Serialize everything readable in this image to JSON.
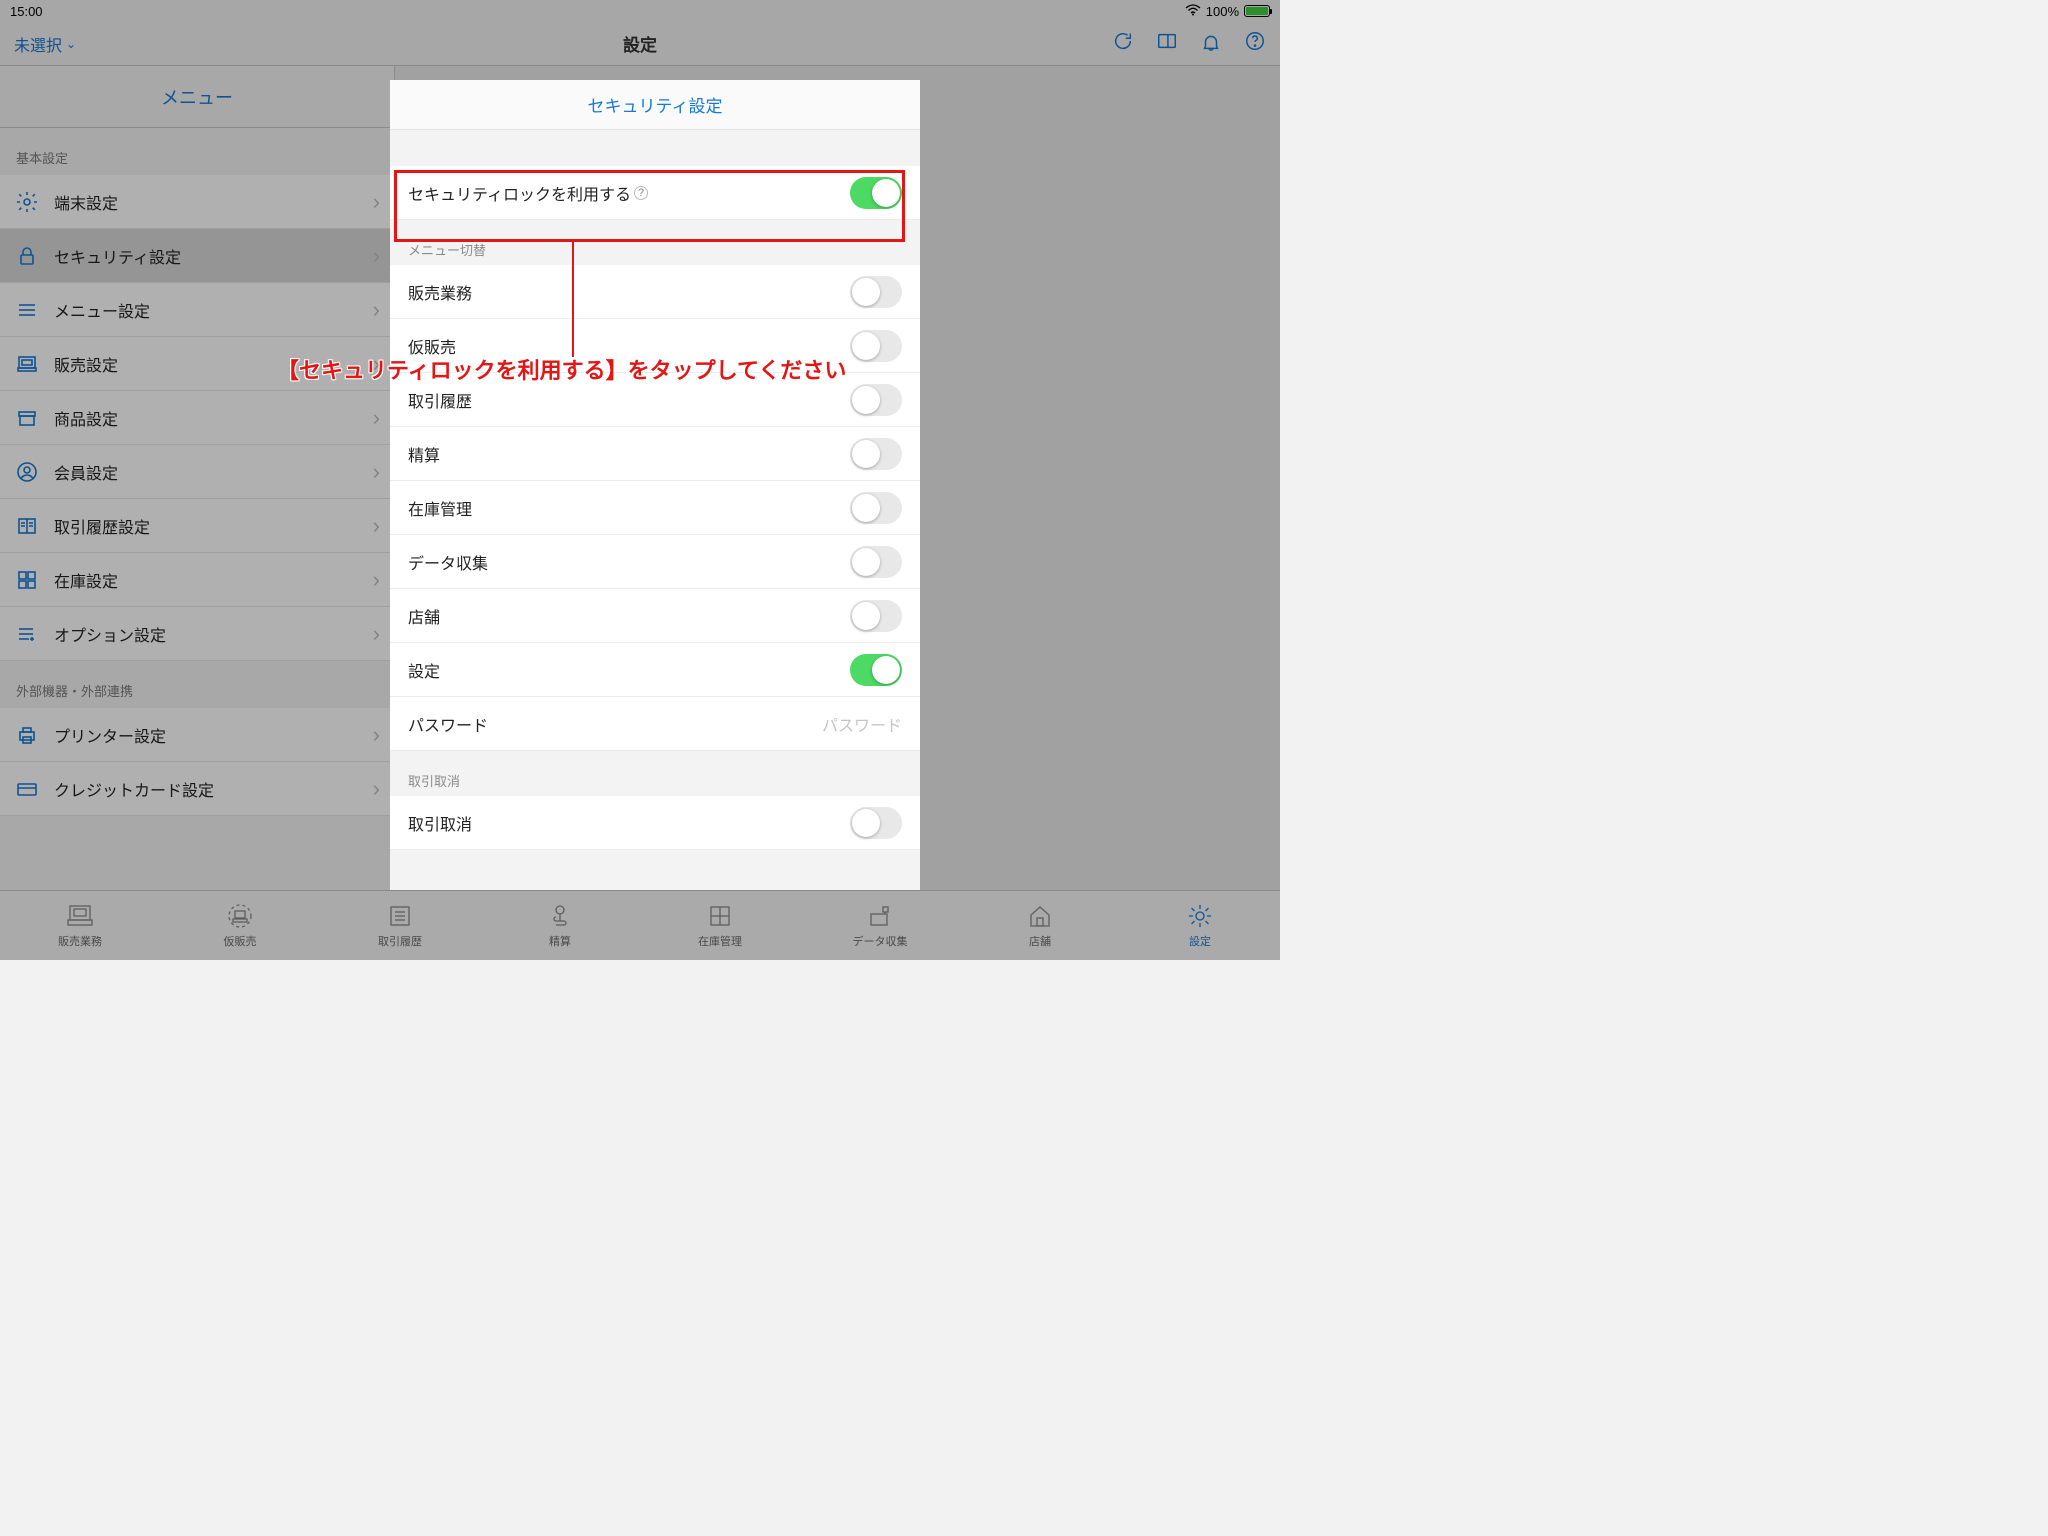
{
  "status": {
    "time": "15:00",
    "battery": "100%"
  },
  "topnav": {
    "leftLabel": "未選択",
    "title": "設定"
  },
  "leftPane": {
    "header": "メニュー",
    "section1": "基本設定",
    "items1": [
      {
        "label": "端末設定"
      },
      {
        "label": "セキュリティ設定"
      },
      {
        "label": "メニュー設定"
      },
      {
        "label": "販売設定"
      },
      {
        "label": "商品設定"
      },
      {
        "label": "会員設定"
      },
      {
        "label": "取引履歴設定"
      },
      {
        "label": "在庫設定"
      },
      {
        "label": "オプション設定"
      }
    ],
    "section2": "外部機器・外部連携",
    "items2": [
      {
        "label": "プリンター設定"
      },
      {
        "label": "クレジットカード設定"
      }
    ]
  },
  "modal": {
    "title": "セキュリティ設定",
    "lockLabel": "セキュリティロックを利用する",
    "menuSwitchTitle": "メニュー切替",
    "rows": [
      {
        "label": "販売業務",
        "on": false
      },
      {
        "label": "仮販売",
        "on": false
      },
      {
        "label": "取引履歴",
        "on": false
      },
      {
        "label": "精算",
        "on": false
      },
      {
        "label": "在庫管理",
        "on": false
      },
      {
        "label": "データ収集",
        "on": false
      },
      {
        "label": "店舗",
        "on": false
      },
      {
        "label": "設定",
        "on": true
      }
    ],
    "passwordLabel": "パスワード",
    "passwordPlaceholder": "パスワード",
    "section2Title": "取引取消",
    "cancelRow": "取引取消"
  },
  "tabs": [
    {
      "label": "販売業務"
    },
    {
      "label": "仮販売"
    },
    {
      "label": "取引履歴"
    },
    {
      "label": "精算"
    },
    {
      "label": "在庫管理"
    },
    {
      "label": "データ収集"
    },
    {
      "label": "店舗"
    },
    {
      "label": "設定"
    }
  ],
  "callout": "【セキュリティロックを利用する】をタップしてください"
}
